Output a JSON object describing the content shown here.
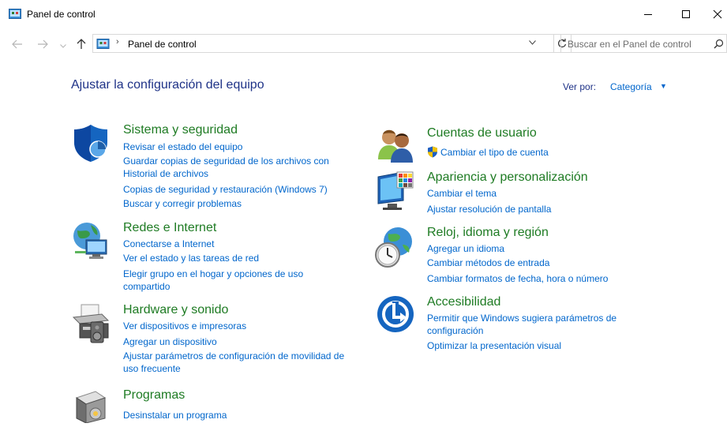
{
  "window": {
    "title": "Panel de control"
  },
  "address": {
    "path": "Panel de control",
    "search_placeholder": "Buscar en el Panel de control"
  },
  "main": {
    "heading": "Ajustar la configuración del equipo",
    "view_by_label": "Ver por:",
    "view_by_value": "Categoría"
  },
  "categories_left": [
    {
      "title": "Sistema y seguridad",
      "links": [
        "Revisar el estado del equipo",
        "Guardar copias de seguridad de los archivos con",
        "Historial de archivos",
        "Copias de seguridad y restauración (Windows 7)",
        "Buscar y corregir problemas"
      ]
    },
    {
      "title": "Redes e Internet",
      "links": [
        "Conectarse a Internet",
        "Ver el estado y las tareas de red",
        "Elegir grupo en el hogar y opciones de uso",
        "compartido"
      ]
    },
    {
      "title": "Hardware y sonido",
      "links": [
        "Ver dispositivos e impresoras",
        "Agregar un dispositivo",
        "Ajustar parámetros de configuración de movilidad de",
        "uso frecuente"
      ]
    },
    {
      "title": "Programas",
      "links": [
        "Desinstalar un programa"
      ]
    }
  ],
  "categories_right": [
    {
      "title": "Cuentas de usuario",
      "links": [
        "Cambiar el tipo de cuenta"
      ]
    },
    {
      "title": "Apariencia y personalización",
      "links": [
        "Cambiar el tema",
        "Ajustar resolución de pantalla"
      ]
    },
    {
      "title": "Reloj, idioma y región",
      "links": [
        "Agregar un idioma",
        "Cambiar métodos de entrada",
        "Cambiar formatos de fecha, hora o número"
      ]
    },
    {
      "title": "Accesibilidad",
      "links": [
        "Permitir que Windows sugiera parámetros de",
        "configuración",
        "Optimizar la presentación visual"
      ]
    }
  ]
}
